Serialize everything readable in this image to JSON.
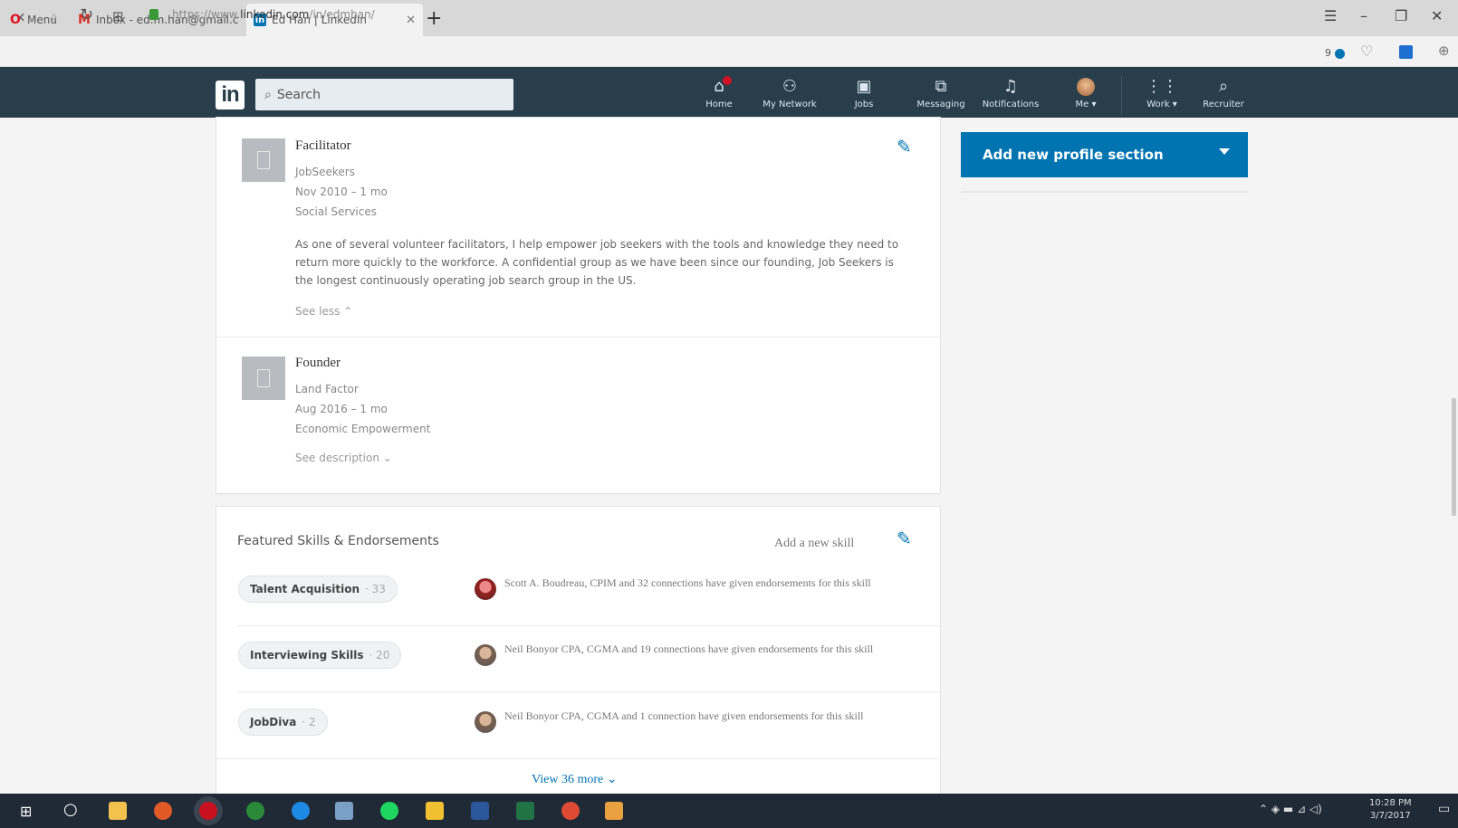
{
  "browser": {
    "menu_label": "Menu",
    "tabs": [
      {
        "title": "Inbox - ed.m.han@gmail.c"
      },
      {
        "title": "Ed Han | LinkedIn"
      }
    ],
    "address": {
      "prefix": "https://www.",
      "host": "linkedin.com",
      "path": "/in/edmhan/"
    },
    "speed_dial_count": "9"
  },
  "linkedin": {
    "logo_text": "in",
    "search_placeholder": "Search",
    "nav": [
      {
        "label": "Home",
        "icon": "home-icon"
      },
      {
        "label": "My Network",
        "icon": "people-icon"
      },
      {
        "label": "Jobs",
        "icon": "briefcase-icon"
      },
      {
        "label": "Messaging",
        "icon": "messaging-icon"
      },
      {
        "label": "Notifications",
        "icon": "bell-icon"
      },
      {
        "label": "Me ▾",
        "icon": "avatar"
      },
      {
        "label": "Work ▾",
        "icon": "grid-icon"
      },
      {
        "label": "Recruiter",
        "icon": "recruiter-icon"
      }
    ],
    "colors": {
      "header": "#283e4a",
      "accent": "#0073b1"
    }
  },
  "experience": [
    {
      "title": "Facilitator",
      "org": "JobSeekers",
      "dates": "Nov 2010 – 1 mo",
      "category": "Social Services",
      "description": "As one of several volunteer facilitators, I help empower job seekers with the tools and knowledge they need to return more quickly to the workforce. A confidential group as we have been since our founding, Job Seekers is the longest continuously operating job search group in the US.",
      "toggle": "See less"
    },
    {
      "title": "Founder",
      "org": "Land Factor",
      "dates": "Aug 2016 – 1 mo",
      "category": "Economic Empowerment",
      "toggle": "See description"
    }
  ],
  "skills": {
    "heading": "Featured Skills & Endorsements",
    "add_label": "Add a new skill",
    "items": [
      {
        "name": "Talent Acquisition",
        "count": "33",
        "endorsement": "Scott A. Boudreau, CPIM and 32 connections have given endorsements for this skill"
      },
      {
        "name": "Interviewing Skills",
        "count": "20",
        "endorsement": "Neil Bonyor CPA, CGMA and 19 connections have given endorsements for this skill"
      },
      {
        "name": "JobDiva",
        "count": "2",
        "endorsement": "Neil Bonyor CPA, CGMA and 1 connection have given endorsements for this skill"
      }
    ],
    "view_more": "View 36 more"
  },
  "sidebar": {
    "add_section_label": "Add new profile section"
  },
  "taskbar": {
    "time": "10:28 PM",
    "date": "3/7/2017"
  }
}
